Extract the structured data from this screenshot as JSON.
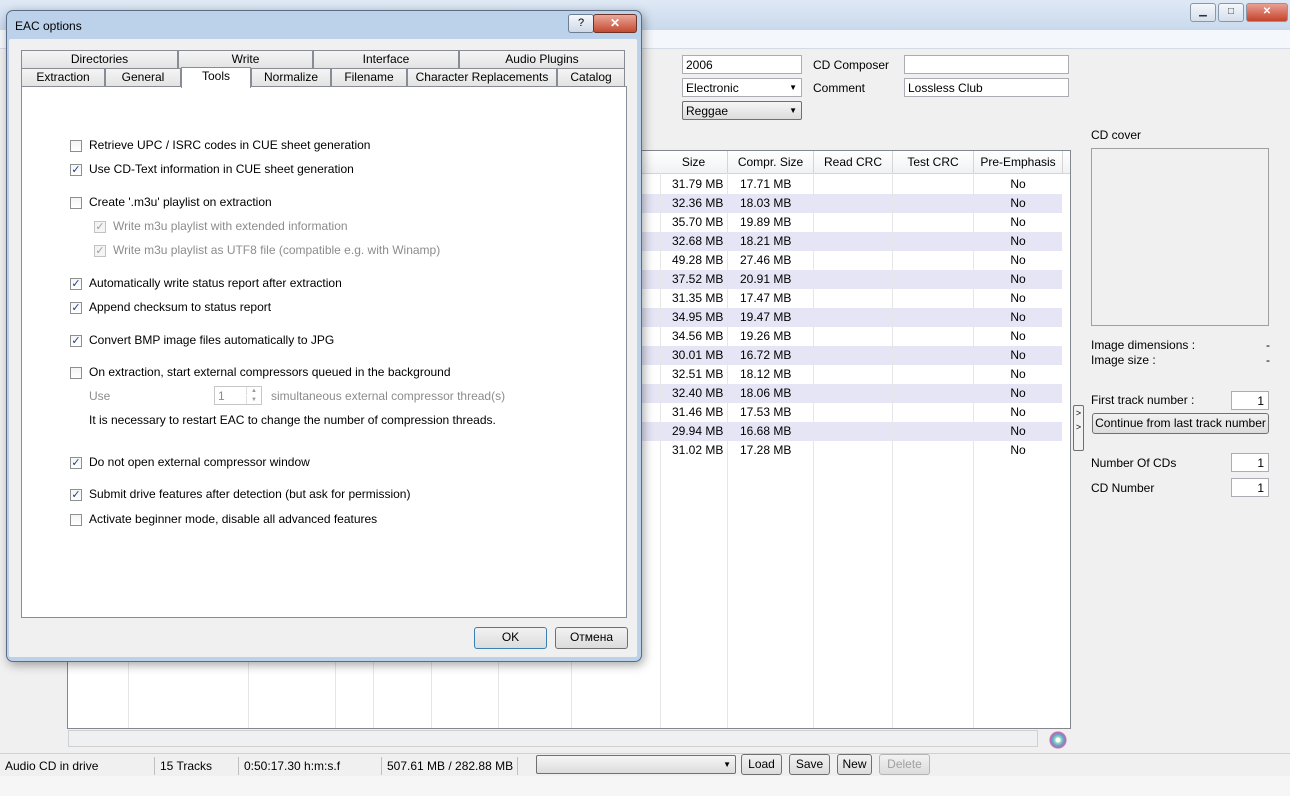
{
  "main": {
    "year": "2006",
    "genre": "Electronic",
    "style": "Reggae",
    "cd_composer_label": "CD Composer",
    "cd_composer": "",
    "comment_label": "Comment",
    "comment": "Lossless Club",
    "table": {
      "headers": [
        "Size",
        "Compr. Size",
        "Read CRC",
        "Test CRC",
        "Pre-Emphasis"
      ],
      "rows": [
        [
          "31.79 MB",
          "17.71 MB",
          "",
          "",
          "No"
        ],
        [
          "32.36 MB",
          "18.03 MB",
          "",
          "",
          "No"
        ],
        [
          "35.70 MB",
          "19.89 MB",
          "",
          "",
          "No"
        ],
        [
          "32.68 MB",
          "18.21 MB",
          "",
          "",
          "No"
        ],
        [
          "49.28 MB",
          "27.46 MB",
          "",
          "",
          "No"
        ],
        [
          "37.52 MB",
          "20.91 MB",
          "",
          "",
          "No"
        ],
        [
          "31.35 MB",
          "17.47 MB",
          "",
          "",
          "No"
        ],
        [
          "34.95 MB",
          "19.47 MB",
          "",
          "",
          "No"
        ],
        [
          "34.56 MB",
          "19.26 MB",
          "",
          "",
          "No"
        ],
        [
          "30.01 MB",
          "16.72 MB",
          "",
          "",
          "No"
        ],
        [
          "32.51 MB",
          "18.12 MB",
          "",
          "",
          "No"
        ],
        [
          "32.40 MB",
          "18.06 MB",
          "",
          "",
          "No"
        ],
        [
          "31.46 MB",
          "17.53 MB",
          "",
          "",
          "No"
        ],
        [
          "29.94 MB",
          "16.68 MB",
          "",
          "",
          "No"
        ],
        [
          "31.02 MB",
          "17.28 MB",
          "",
          "",
          "No"
        ]
      ]
    },
    "right_panel": {
      "cd_cover": "CD cover",
      "image_dimensions_label": "Image dimensions :",
      "image_dimensions_value": "-",
      "image_size_label": "Image size :",
      "image_size_value": "-",
      "first_track_label": "First track number :",
      "first_track_value": "1",
      "continue_button": "Continue from last track number",
      "number_of_cds_label": "Number Of CDs",
      "number_of_cds_value": "1",
      "cd_number_label": "CD Number",
      "cd_number_value": "1",
      "side_arrow": "> >"
    },
    "status": {
      "drive": "Audio CD in drive",
      "tracks": "15 Tracks",
      "duration": "0:50:17.30 h:m:s.f",
      "sizes": "507.61 MB / 282.88 MB",
      "load": "Load",
      "save": "Save",
      "new": "New",
      "delete": "Delete"
    },
    "window_buttons": {
      "minimize": "▁",
      "maximize": "□",
      "close": "✕"
    }
  },
  "dialog": {
    "title": "EAC options",
    "help": "?",
    "close": "✕",
    "tabs_row1": [
      "Directories",
      "Write",
      "Interface",
      "Audio Plugins"
    ],
    "tabs_row2": [
      "Extraction",
      "General",
      "Tools",
      "Normalize",
      "Filename",
      "Character Replacements",
      "Catalog"
    ],
    "active_tab": "Tools",
    "options": [
      {
        "label": "Retrieve UPC / ISRC codes in CUE sheet generation",
        "checked": false,
        "disabled": false
      },
      {
        "label": "Use CD-Text information in CUE sheet generation",
        "checked": true,
        "disabled": false
      },
      {
        "label": "Create '.m3u' playlist on extraction",
        "checked": false,
        "disabled": false
      },
      {
        "label": "Write m3u playlist with extended information",
        "checked": true,
        "disabled": true
      },
      {
        "label": "Write m3u playlist as UTF8 file (compatible e.g. with Winamp)",
        "checked": true,
        "disabled": true
      },
      {
        "label": "Automatically write status report after extraction",
        "checked": true,
        "disabled": false
      },
      {
        "label": "Append checksum to status report",
        "checked": true,
        "disabled": false
      },
      {
        "label": "Convert BMP image files automatically to JPG",
        "checked": true,
        "disabled": false
      },
      {
        "label": "On extraction, start external compressors queued in the background",
        "checked": false,
        "disabled": false
      },
      {
        "label": "Do not open external compressor window",
        "checked": true,
        "disabled": false
      },
      {
        "label": "Submit drive features after detection (but ask for permission)",
        "checked": true,
        "disabled": false
      },
      {
        "label": "Activate beginner mode, disable all advanced features",
        "checked": false,
        "disabled": false
      }
    ],
    "use_label": "Use",
    "threads_value": "1",
    "threads_label": "simultaneous external compressor thread(s)",
    "restart_note": "It is necessary to restart EAC to change the number of compression threads.",
    "ok": "OK",
    "cancel": "Отмена"
  }
}
